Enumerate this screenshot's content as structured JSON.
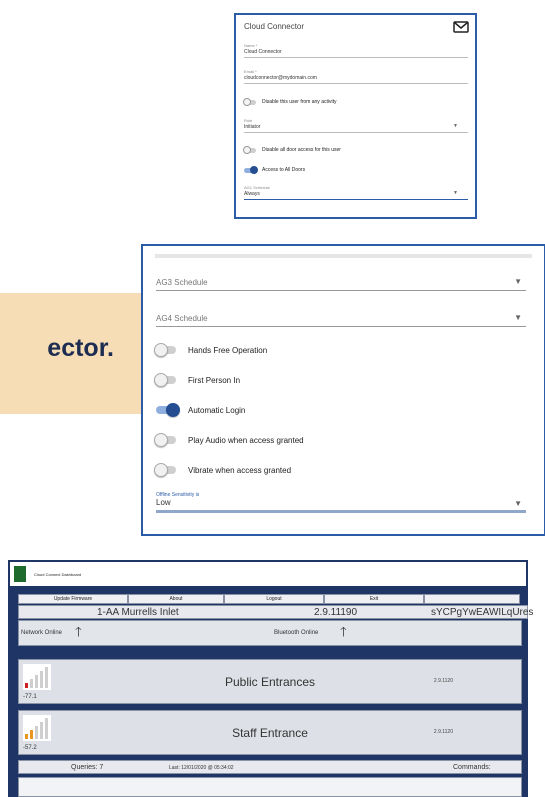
{
  "user_form": {
    "title": "Cloud Connector",
    "name_label": "Name *",
    "name_value": "Cloud Connector",
    "email_label": "Email *",
    "email_value": "cloudconnector@mydomain.com",
    "disable_activity_label": "Disable this user from any activity",
    "disable_activity_on": false,
    "role_label": "Role",
    "role_value": "Initiator",
    "disable_door_label": "Disable all door access for this user",
    "disable_door_on": false,
    "all_doors_label": "Access to All Doors",
    "all_doors_on": true,
    "ag_schedule_label": "AG1 Schedule",
    "ag_schedule_value": "Always"
  },
  "settings": {
    "ag3_schedule": "AG3 Schedule",
    "ag4_schedule": "AG4 Schedule",
    "toggles": [
      {
        "label": "Hands Free Operation",
        "on": false
      },
      {
        "label": "First Person In",
        "on": false
      },
      {
        "label": "Automatic Login",
        "on": true
      },
      {
        "label": "Play Audio when access granted",
        "on": false
      },
      {
        "label": "Vibrate when access granted",
        "on": false
      }
    ],
    "offline_label": "Offline Sensitivity is",
    "offline_value": "Low"
  },
  "banner": {
    "text": "ector."
  },
  "dashboard": {
    "title": "Cloud Connect Dashboard",
    "buttons": [
      "Update Firmware",
      "About",
      "Logout",
      "Exit"
    ],
    "site_name": "1-AA Murrells Inlet",
    "version": "2.9.11190",
    "serial": "sYCPgYwEAWILqUres",
    "network_status": "Network Online",
    "bluetooth_status": "Bluetooth Online",
    "entrances": [
      {
        "name": "Public Entrances",
        "rssi": "-77.1",
        "version": "2.9.1120",
        "signal_color": "#d02020",
        "bars": 1
      },
      {
        "name": "Staff Entrance",
        "rssi": "-57.2",
        "version": "2.9.1120",
        "signal_color": "#e8961e",
        "bars": 2
      }
    ],
    "queries": "Queries: 7",
    "last": "Last: 12/01/2020 @ 05:34:02",
    "commands": "Commands:"
  }
}
